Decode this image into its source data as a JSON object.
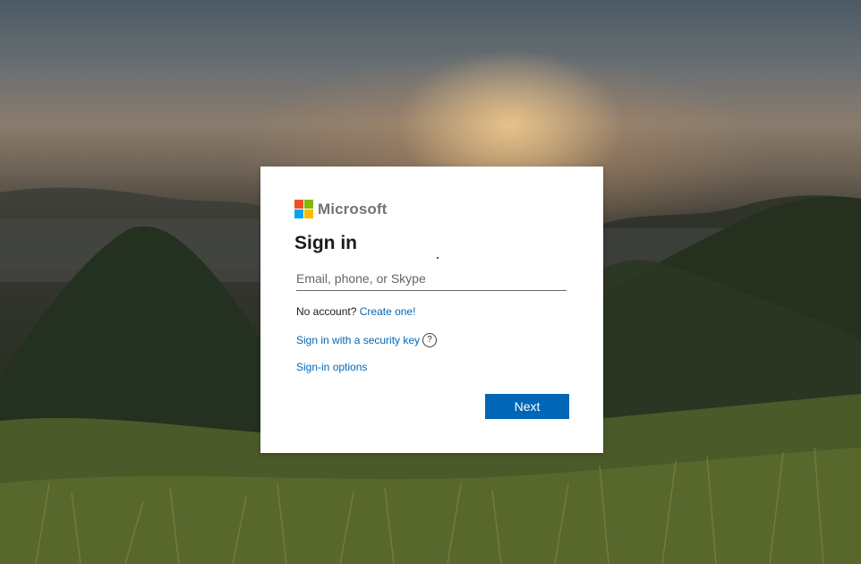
{
  "brand": {
    "name": "Microsoft",
    "logo_colors": [
      "#f25022",
      "#7fba00",
      "#00a4ef",
      "#ffb900"
    ]
  },
  "signin": {
    "title": "Sign in",
    "email_placeholder": "Email, phone, or Skype",
    "no_account_text": "No account?",
    "create_link": "Create one!",
    "security_key_link": "Sign in with a security key",
    "help_icon": "question-circle-icon",
    "help_glyph": "?",
    "options_link": "Sign-in options",
    "next_label": "Next"
  },
  "colors": {
    "accent": "#0067b8",
    "card_bg": "#ffffff",
    "text": "#1b1b1b"
  }
}
